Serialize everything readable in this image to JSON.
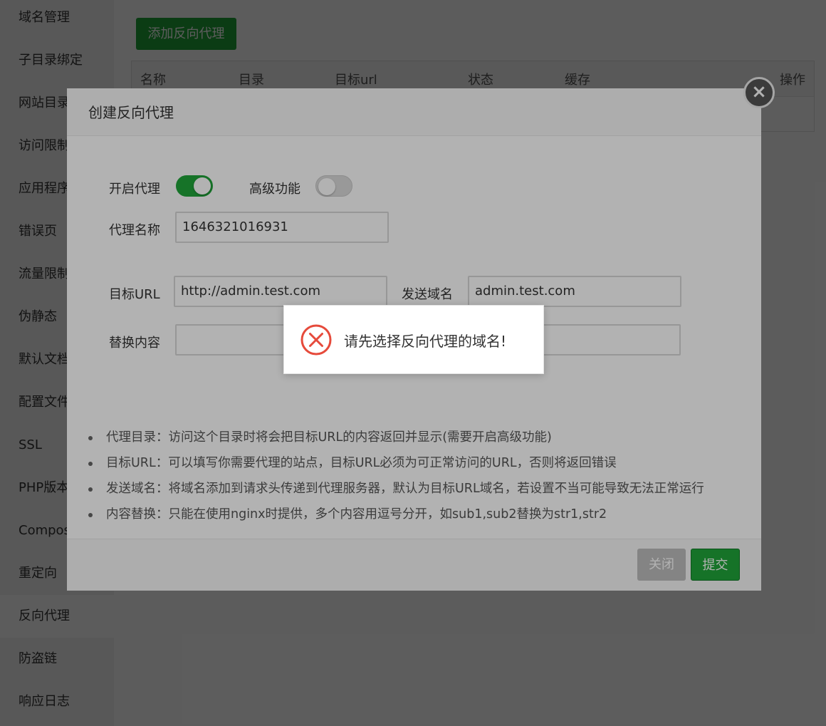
{
  "sidebar": {
    "items": [
      {
        "label": "域名管理"
      },
      {
        "label": "子目录绑定"
      },
      {
        "label": "网站目录"
      },
      {
        "label": "访问限制"
      },
      {
        "label": "应用程序"
      },
      {
        "label": "错误页"
      },
      {
        "label": "流量限制"
      },
      {
        "label": "伪静态"
      },
      {
        "label": "默认文档"
      },
      {
        "label": "配置文件"
      },
      {
        "label": "SSL"
      },
      {
        "label": "PHP版本"
      },
      {
        "label": "Composer"
      },
      {
        "label": "重定向"
      },
      {
        "label": "反向代理"
      },
      {
        "label": "防盗链"
      },
      {
        "label": "响应日志"
      }
    ],
    "active": "反向代理"
  },
  "main": {
    "add_button": "添加反向代理",
    "table": {
      "headers": [
        "名称",
        "目录",
        "目标url",
        "状态",
        "缓存",
        "操作"
      ]
    }
  },
  "modal": {
    "title": "创建反向代理",
    "close_icon": "close-icon",
    "enable_proxy_label": "开启代理",
    "enable_proxy_on": true,
    "advanced_label": "高级功能",
    "advanced_on": false,
    "proxy_name_label": "代理名称",
    "proxy_name_value": "1646321016931",
    "target_url_label": "目标URL",
    "target_url_value": "http://admin.test.com",
    "send_domain_label": "发送域名",
    "send_domain_value": "admin.test.com",
    "replace_label": "替换内容",
    "replace_value": "",
    "replace_value_2": "",
    "tips": [
      "代理目录：访问这个目录时将会把目标URL的内容返回并显示(需要开启高级功能)",
      "目标URL：可以填写你需要代理的站点，目标URL必须为可正常访问的URL，否则将返回错误",
      "发送域名：将域名添加到请求头传递到代理服务器，默认为目标URL域名，若设置不当可能导致无法正常运行",
      "内容替换：只能在使用nginx时提供，多个内容用逗号分开，如sub1,sub2替换为str1,str2"
    ],
    "close_button": "关闭",
    "submit_button": "提交"
  },
  "alert": {
    "icon": "error-icon",
    "message": "请先选择反向代理的域名!",
    "color": "#e64a3b"
  },
  "colors": {
    "brand_green": "#20a53a"
  }
}
